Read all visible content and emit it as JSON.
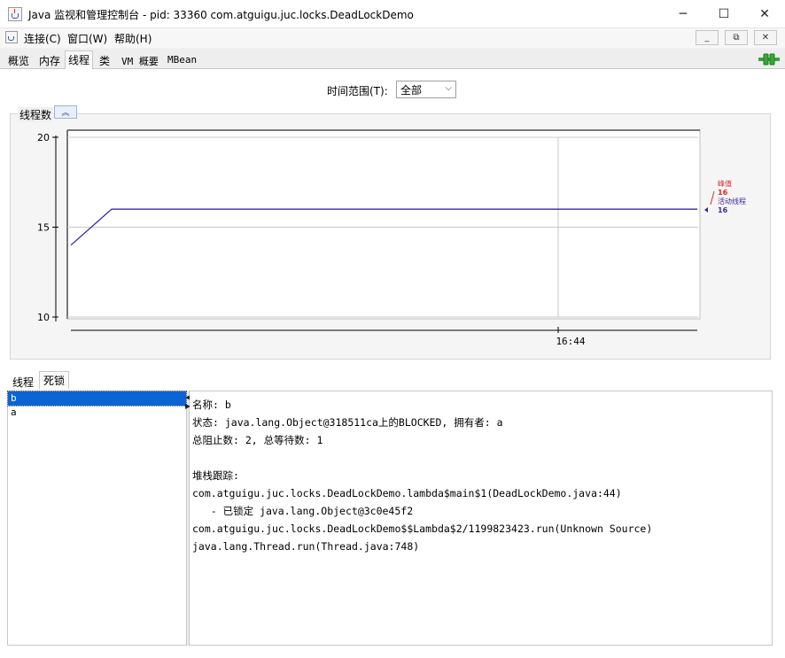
{
  "window": {
    "title": "Java 监视和管理控制台 - pid: 33360 com.atguigu.juc.locks.DeadLockDemo",
    "minimize": "─",
    "maximize": "☐",
    "close": "✕",
    "app_icon": "java-cup-icon"
  },
  "menu": {
    "items": [
      "连接(C)",
      "窗口(W)",
      "帮助(H)"
    ],
    "mdi_buttons": [
      "_",
      "⧉",
      "✕"
    ]
  },
  "tabs": [
    {
      "label": "概览",
      "active": false
    },
    {
      "label": "内存",
      "active": false
    },
    {
      "label": "线程",
      "active": true
    },
    {
      "label": "类",
      "active": false
    },
    {
      "label": "VM 概要",
      "active": false
    },
    {
      "label": "MBean",
      "active": false
    }
  ],
  "time_range": {
    "label": "时间范围(T):",
    "value": "全部"
  },
  "chart_panel": {
    "title": "线程数",
    "collapse_icon": "chevron-up-double-icon"
  },
  "chart_data": {
    "type": "line",
    "title": "线程数",
    "y_ticks": [
      "20",
      "15",
      "10"
    ],
    "ylim": [
      10,
      20
    ],
    "x_ticks": [
      "16:44"
    ],
    "series": [
      {
        "name": "峰值",
        "color": "#d92b2b",
        "value": 16,
        "points": [
          14,
          16,
          16
        ]
      },
      {
        "name": "活动线程",
        "color": "#3a2a9a",
        "value": 16,
        "points": [
          14,
          16,
          16
        ]
      }
    ],
    "grid": true,
    "legend_placement": "right",
    "legend": {
      "peak_label": "峰值",
      "peak_value": "16",
      "live_label": "活动线程",
      "live_value": "16"
    }
  },
  "bottom_tabs": [
    {
      "label": "线程",
      "active": false
    },
    {
      "label": "死锁",
      "active": true
    }
  ],
  "thread_list": [
    {
      "name": "b",
      "selected": true
    },
    {
      "name": "a",
      "selected": false
    }
  ],
  "detail": {
    "lines": [
      "名称: b",
      "状态: java.lang.Object@318511ca上的BLOCKED, 拥有者: a",
      "总阻止数: 2, 总等待数: 1",
      "",
      "堆栈跟踪:",
      "com.atguigu.juc.locks.DeadLockDemo.lambda$main$1(DeadLockDemo.java:44)",
      "   - 已锁定 java.lang.Object@3c0e45f2",
      "com.atguigu.juc.locks.DeadLockDemo$$Lambda$2/1199823423.run(Unknown Source)",
      "java.lang.Thread.run(Thread.java:748)"
    ]
  },
  "colors": {
    "selection": "#0a64d4",
    "live_line": "#3a2a9a",
    "peak": "#d92b2b",
    "connected_plug": "#3aa53a"
  }
}
